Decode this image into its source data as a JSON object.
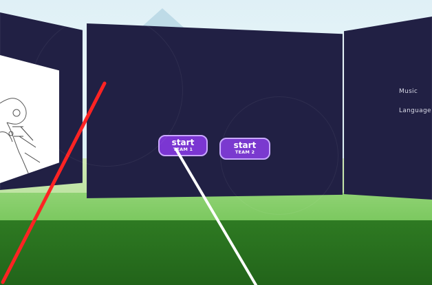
{
  "center_panel": {
    "buttons": [
      {
        "title": "start",
        "subtitle": "TEAM 1"
      },
      {
        "title": "start",
        "subtitle": "TEAM 2"
      }
    ]
  },
  "right_panel": {
    "settings": [
      "Music",
      "Language"
    ]
  },
  "colors": {
    "panel_bg": "#212044",
    "button_fill": "#7a38cf",
    "button_border": "#c6a7ff",
    "grass": "#2e7a22",
    "pointer_red": "#ff2323",
    "pointer_white": "#ffffff"
  },
  "icons": {
    "left_panel_image": "controller-diagram-icon"
  }
}
